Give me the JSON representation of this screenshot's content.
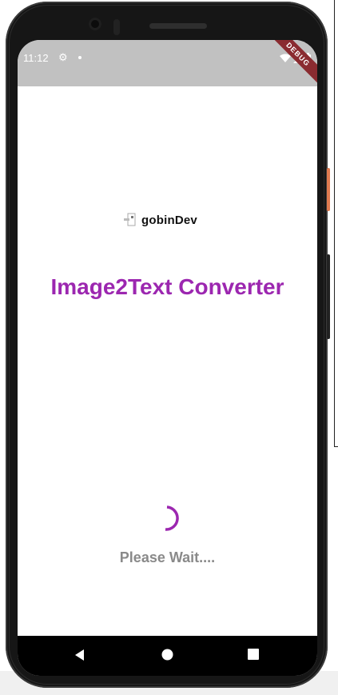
{
  "status_bar": {
    "time": "11:12",
    "debug_label": "DEBUG"
  },
  "splash": {
    "logo_text": "gobinDev",
    "title": "Image2Text Converter",
    "loading_text": "Please Wait...."
  },
  "colors": {
    "title": "#9c27b0",
    "spinner": "#9c27b0",
    "status_bar": "#c1c1c1",
    "debug_banner": "#8a2b30",
    "nav_bar": "#000000"
  },
  "navigation": {
    "buttons": [
      "back-icon",
      "home-icon",
      "recents-icon"
    ]
  }
}
